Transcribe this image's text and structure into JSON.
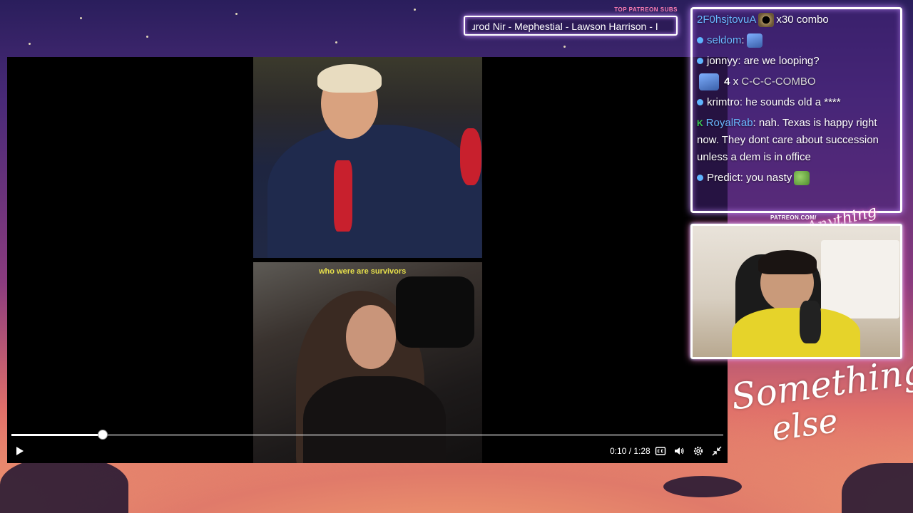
{
  "ticker": {
    "label": "TOP PATREON SUBS",
    "text": "ɹrod Nir - Mephestial - Lawson Harrison - I"
  },
  "player": {
    "caption": "who were are survivors",
    "time": "0:10 / 1:28",
    "progress": 0.128
  },
  "chat": {
    "messages": [
      {
        "user": "2F0hsjtovuA",
        "text": "x30 combo",
        "type": "combo",
        "emote": "emote-black-hole"
      },
      {
        "user": "seldom",
        "text": ":",
        "type": "emote-only",
        "emote": "emote-blue-character"
      },
      {
        "user": "jonnyy",
        "text": "are we looping?"
      },
      {
        "count": "4",
        "x": "x",
        "text": "C-C-C-COMBO",
        "type": "combo-counter",
        "emote": "emote-blue-character"
      },
      {
        "user": "krimtro",
        "text": "he sounds old a ****"
      },
      {
        "user": "RoyalRab",
        "text": "nah. Texas is happy right now. They dont care about succession unless a dem is in office",
        "badge": "K"
      },
      {
        "user": "Predict",
        "text": "you nasty",
        "emote": "emote-pepe"
      }
    ]
  },
  "webcam": {
    "label": "PATREON.COM/",
    "logo": "Anything else"
  },
  "brand": {
    "line1": "Something",
    "line2": "else"
  },
  "colors": {
    "chat_border": "#ffffff",
    "chat_glow": "#c58cff",
    "username_blue": "#6ab8ff",
    "ticker_label": "#ff7fb4",
    "caption_yellow": "#e7e04b"
  }
}
